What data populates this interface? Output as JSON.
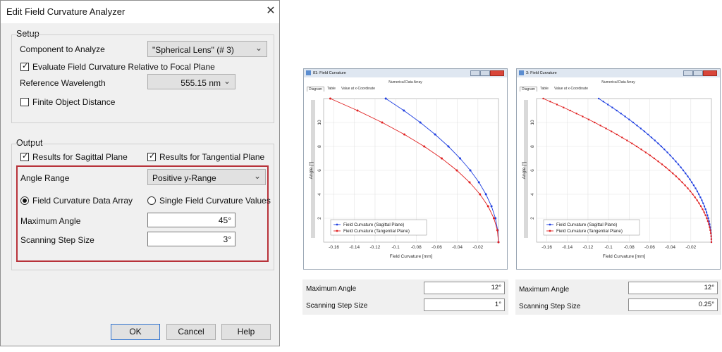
{
  "dialog": {
    "title": "Edit Field Curvature Analyzer",
    "setup": {
      "title": "Setup",
      "component_label": "Component to Analyze",
      "component_value": "\"Spherical Lens\" (# 3)",
      "evaluate_label": "Evaluate Field Curvature Relative to Focal Plane",
      "evaluate_checked": true,
      "wavelength_label": "Reference Wavelength",
      "wavelength_value": "555.15 nm",
      "finite_label": "Finite Object Distance",
      "finite_checked": false
    },
    "output": {
      "title": "Output",
      "sagittal_label": "Results for Sagittal Plane",
      "tangential_label": "Results for Tangential Plane",
      "angle_range_label": "Angle Range",
      "angle_range_value": "Positive y-Range",
      "data_array_label": "Field Curvature Data Array",
      "single_values_label": "Single Field Curvature Values",
      "max_angle_label": "Maximum Angle",
      "max_angle_value": "45°",
      "step_label": "Scanning Step Size",
      "step_value": "3°"
    },
    "buttons": {
      "ok": "OK",
      "cancel": "Cancel",
      "help": "Help"
    }
  },
  "charts": [
    {
      "window_title": "81: Field Curvature",
      "header": "Numerical Data Array",
      "tabs": [
        "Diagram",
        "Table",
        "Value at x-Coordinate"
      ],
      "max_angle_label": "Maximum Angle",
      "max_angle_value": "12°",
      "step_label": "Scanning Step Size",
      "step_value": "1°"
    },
    {
      "window_title": "3: Field Curvature",
      "header": "Numerical Data Array",
      "tabs": [
        "Diagram",
        "Table",
        "Value at x-Coordinate"
      ],
      "max_angle_label": "Maximum Angle",
      "max_angle_value": "12°",
      "step_label": "Scanning Step Size",
      "step_value": "0.25°"
    }
  ],
  "colors": {
    "sagittal": "#1f3fe0",
    "tangential": "#e02020",
    "highlight": "#b8323a"
  },
  "chart_data": [
    {
      "type": "line",
      "xlabel": "Field Curvature [mm]",
      "ylabel": "Angle [°]",
      "xlim": [
        -0.17,
        0
      ],
      "ylim": [
        0,
        12
      ],
      "x_ticks": [
        "-0.16",
        "-0.14",
        "-0.12",
        "-0.1",
        "-0.08",
        "-0.06",
        "-0.04",
        "-0.02"
      ],
      "y_ticks": [
        "2",
        "4",
        "6",
        "8",
        "10"
      ],
      "legend_position": "bottom-left",
      "series": [
        {
          "name": "Field Curvature (Sagittal Plane)",
          "y": [
            0,
            1,
            2,
            3,
            4,
            5,
            6,
            7,
            8,
            9,
            10,
            11,
            12
          ],
          "x": [
            0,
            -0.0008,
            -0.003,
            -0.0068,
            -0.0122,
            -0.019,
            -0.0274,
            -0.0373,
            -0.0487,
            -0.0616,
            -0.076,
            -0.092,
            -0.1096
          ]
        },
        {
          "name": "Field Curvature (Tangential Plane)",
          "y": [
            0,
            1,
            2,
            3,
            4,
            5,
            6,
            7,
            8,
            9,
            10,
            11,
            12
          ],
          "x": [
            0,
            -0.0011,
            -0.0045,
            -0.0101,
            -0.018,
            -0.0281,
            -0.0405,
            -0.0552,
            -0.0722,
            -0.0915,
            -0.1131,
            -0.1371,
            -0.1635
          ]
        }
      ]
    },
    {
      "type": "line",
      "xlabel": "Field Curvature [mm]",
      "ylabel": "Angle [°]",
      "xlim": [
        -0.17,
        0
      ],
      "ylim": [
        0,
        12
      ],
      "x_ticks": [
        "-0.16",
        "-0.14",
        "-0.12",
        "-0.1",
        "-0.08",
        "-0.06",
        "-0.04",
        "-0.02"
      ],
      "y_ticks": [
        "2",
        "4",
        "6",
        "8",
        "10"
      ],
      "legend_position": "bottom-left",
      "series": [
        {
          "name": "Field Curvature (Sagittal Plane)",
          "step": 0.25,
          "y_max": 12,
          "x_at_y_max": -0.1096
        },
        {
          "name": "Field Curvature (Tangential Plane)",
          "step": 0.25,
          "y_max": 12,
          "x_at_y_max": -0.1635
        }
      ]
    }
  ]
}
